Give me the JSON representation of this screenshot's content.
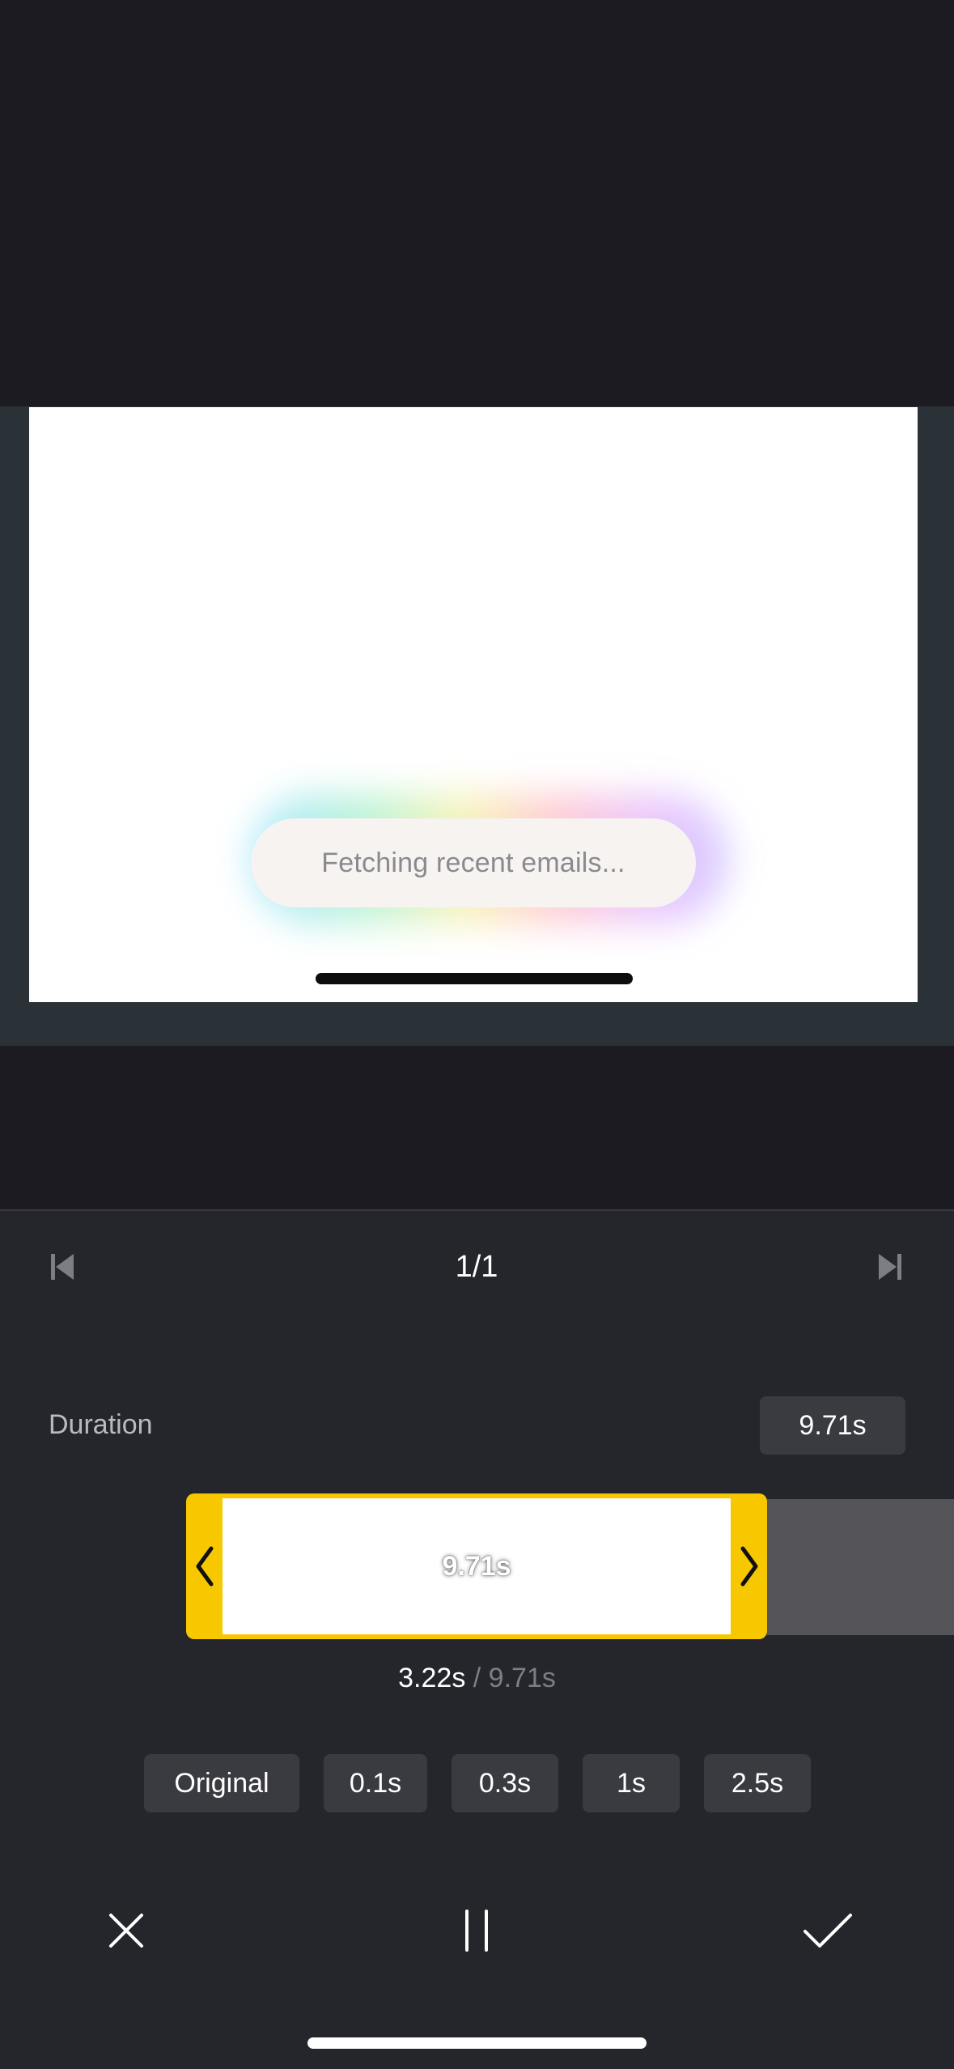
{
  "preview": {
    "toast_text": "Fetching recent emails..."
  },
  "navigation": {
    "page_indicator": "1/1",
    "prev_icon": "skip-previous-icon",
    "next_icon": "skip-next-icon"
  },
  "duration": {
    "label": "Duration",
    "value": "9.71s"
  },
  "timeline": {
    "clip_label": "9.71s",
    "current_time": "3.22s",
    "separator_total": " / 9.71s",
    "accent_color": "#f7c800"
  },
  "presets": [
    {
      "label": "Original"
    },
    {
      "label": "0.1s"
    },
    {
      "label": "0.3s"
    },
    {
      "label": "1s"
    },
    {
      "label": "2.5s"
    }
  ],
  "actions": {
    "cancel_icon": "close-icon",
    "pause_icon": "pause-icon",
    "confirm_icon": "checkmark-icon"
  }
}
